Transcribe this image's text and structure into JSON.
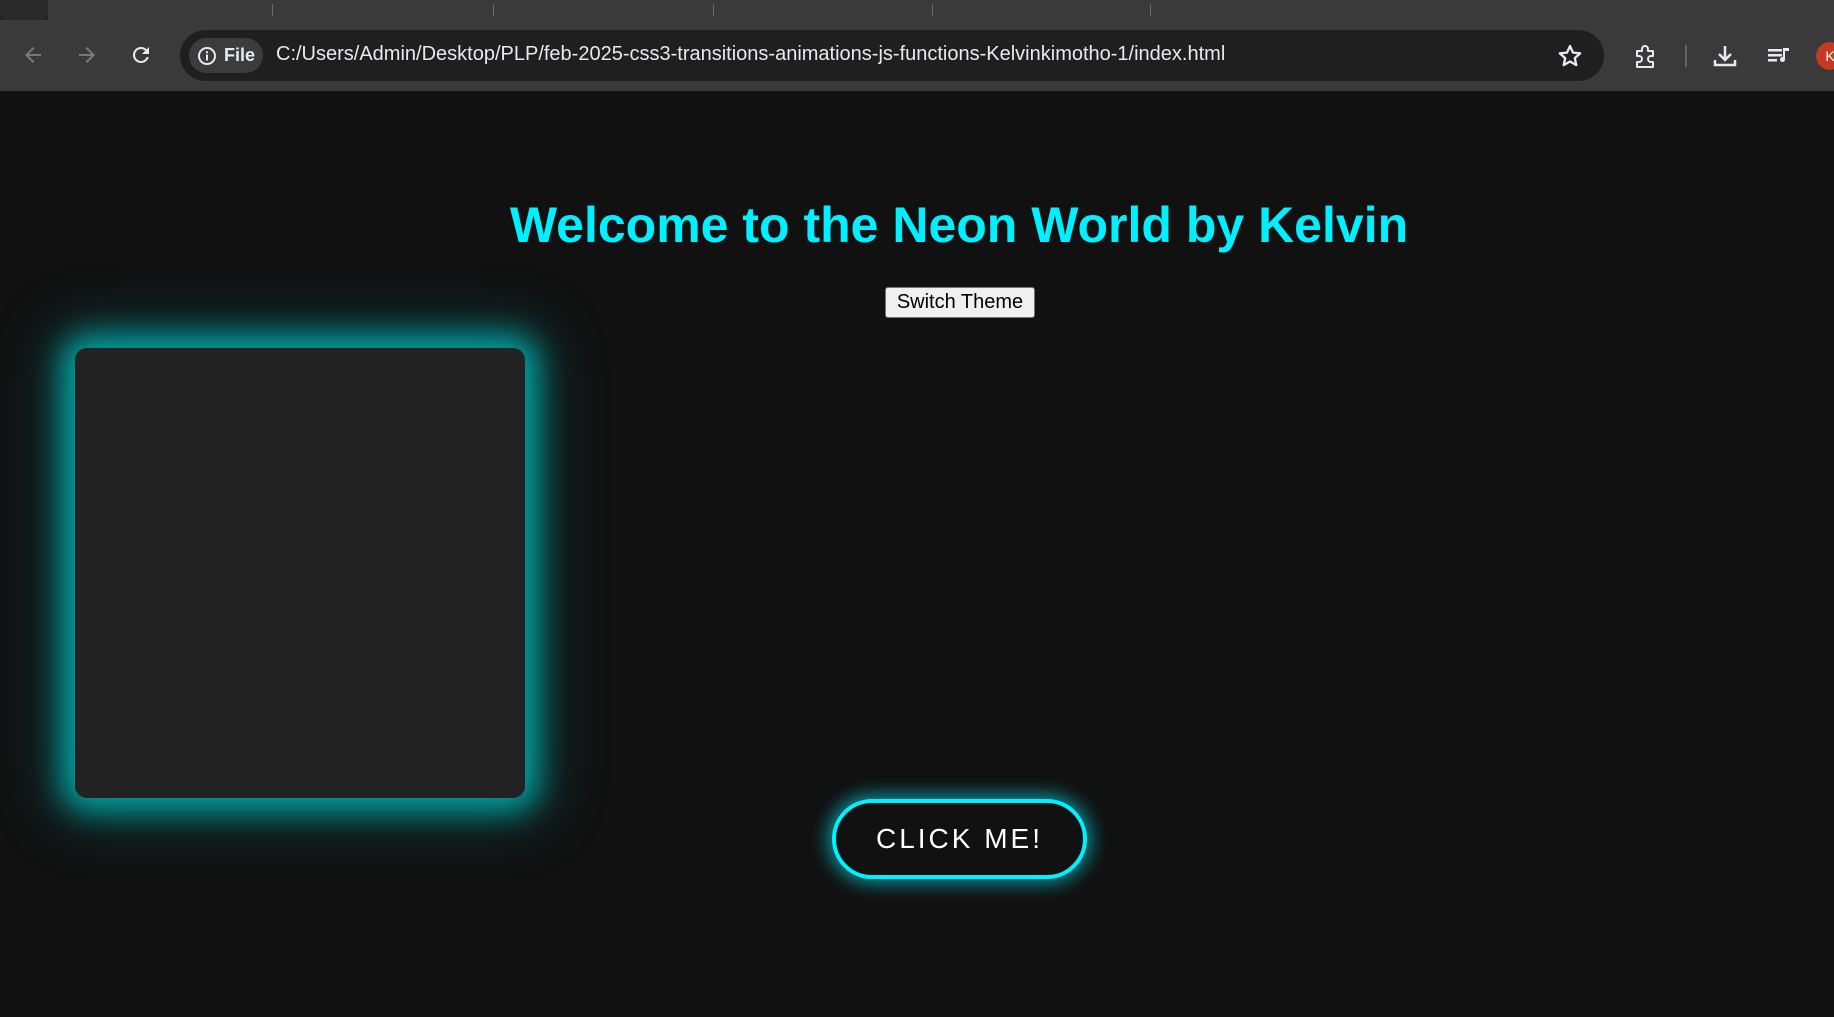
{
  "browser": {
    "address_chip_label": "File",
    "url": "C:/Users/Admin/Desktop/PLP/feb-2025-css3-transitions-animations-js-functions-Kelvinkimotho-1/index.html",
    "profile_initial": "K",
    "icons": {
      "back": "back-arrow-icon",
      "forward": "forward-arrow-icon",
      "reload": "reload-icon",
      "site_info": "info-icon",
      "bookmark": "star-icon",
      "extensions": "puzzle-icon",
      "downloads": "download-icon",
      "media": "media-queue-icon"
    }
  },
  "page": {
    "heading": "Welcome to the Neon World by Kelvin",
    "switch_theme_label": "Switch Theme",
    "click_button_label": "CLICK ME!"
  },
  "colors": {
    "background": "#111111",
    "neon_accent": "#00f0ff",
    "box_fill": "#222222",
    "chrome_bg": "#3a3a3a",
    "omnibox_bg": "#1f1f1f"
  }
}
